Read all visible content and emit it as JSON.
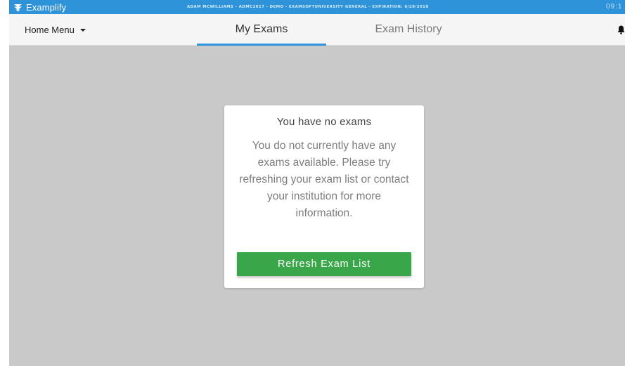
{
  "app": {
    "name": "Examplify",
    "license_line": "ADAM MCWILLIAMS - ADMC2017 - DEMO - EXAMSOFTUNIVERSITY GENERAL - EXPIRATION: 6/29/2018",
    "clock": "09:1",
    "accent_color": "#2e93d8"
  },
  "nav": {
    "home_menu_label": "Home Menu",
    "tabs": [
      {
        "label": "My Exams",
        "active": true
      },
      {
        "label": "Exam History",
        "active": false
      }
    ],
    "notification_icon": "bell-icon"
  },
  "card": {
    "title": "You have no exams",
    "body": "You do not currently have any exams available. Please try refreshing your exam list or contact your institution for more information.",
    "button_label": "Refresh Exam List",
    "button_color": "#3aa64a"
  }
}
